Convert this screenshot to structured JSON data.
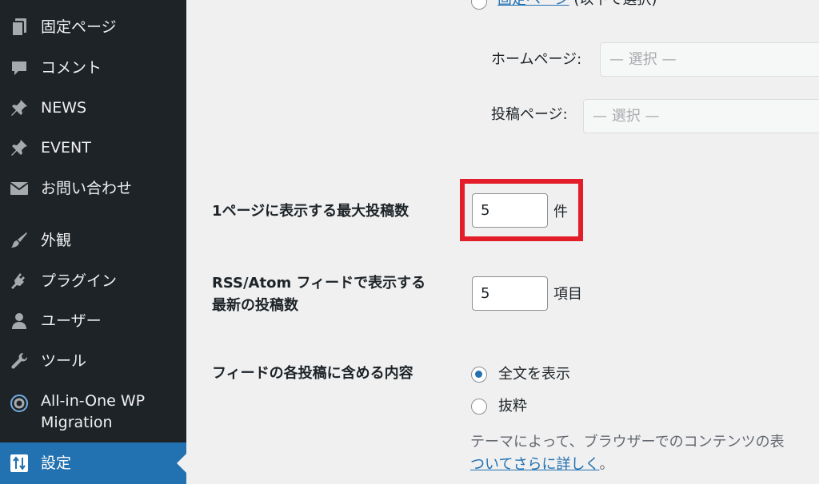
{
  "sidebar": {
    "items": [
      {
        "label": "固定ページ",
        "icon": "pages-icon"
      },
      {
        "label": "コメント",
        "icon": "comment-icon"
      },
      {
        "label": "NEWS",
        "icon": "pin-icon"
      },
      {
        "label": "EVENT",
        "icon": "pin-icon"
      },
      {
        "label": "お問い合わせ",
        "icon": "mail-icon"
      },
      {
        "label": "外観",
        "icon": "paintbrush-icon"
      },
      {
        "label": "プラグイン",
        "icon": "plugin-icon"
      },
      {
        "label": "ユーザー",
        "icon": "user-icon"
      },
      {
        "label": "ツール",
        "icon": "wrench-icon"
      },
      {
        "label_line1": "All-in-One WP",
        "label_line2": "Migration",
        "icon": "migration-icon"
      },
      {
        "label": "設定",
        "icon": "settings-icon",
        "active": true
      }
    ]
  },
  "homepage": {
    "static_page_link": "固定ページ",
    "static_page_suffix": " (以下で選択)",
    "home_label": "ホームページ:",
    "home_select": "— 選択 —",
    "posts_label": "投稿ページ:",
    "posts_select": "— 選択 —"
  },
  "posts_per_page": {
    "label": "1ページに表示する最大投稿数",
    "value": "5",
    "unit": "件"
  },
  "rss": {
    "label_line1": "RSS/Atom フィードで表示する",
    "label_line2": "最新の投稿数",
    "value": "5",
    "unit": "項目"
  },
  "feed_content": {
    "label": "フィードの各投稿に含める内容",
    "option_full": "全文を表示",
    "option_excerpt": "抜粋",
    "selected": "全文を表示",
    "note": "テーマによって、ブラウザーでのコンテンツの表",
    "note_link": "ついてさらに詳しく",
    "note_end": "。"
  },
  "colors": {
    "sidebar_bg": "#1d2327",
    "active_bg": "#2271b1",
    "highlight": "#e41d2b",
    "link": "#2271b1"
  }
}
